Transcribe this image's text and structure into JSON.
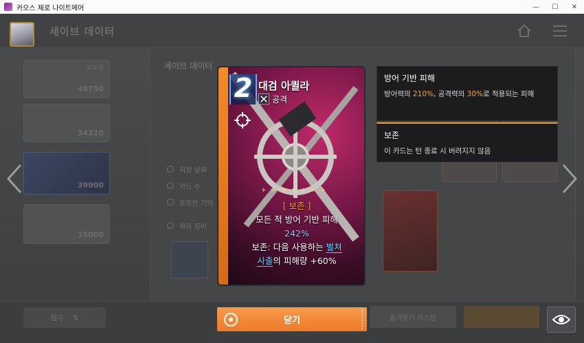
{
  "window": {
    "title": "카오스 제로 나이트메어",
    "minimize": "—",
    "maximize": "☐",
    "close": "✕"
  },
  "background": {
    "page_title": "세이브 데이터",
    "panel_title": "세이브 데이터",
    "slots": [
      {
        "status": "",
        "score": "49750"
      },
      {
        "status": "",
        "score": "34320"
      },
      {
        "status": "",
        "score": "39900"
      },
      {
        "status": "",
        "score": "15000"
      }
    ],
    "slot_header": "장착 중",
    "info_rows": [
      "저장 날짜",
      "카드 수",
      "흐릿한 기억"
    ],
    "equip_label": "획득 장비",
    "sort_label": "점수",
    "ghost_button_label": "즐겨찾기 커스텀"
  },
  "card": {
    "cost": "2",
    "name": "대검 아퀼라",
    "type": "공격",
    "sparkles": "+ + + ✦ + + +",
    "keyword": "[ 보존 ]",
    "line1": "모든 적 방어 기반 피해",
    "line2_value": "242%",
    "line3_prefix": "보존: 다음 사용하는 ",
    "line3_link": "벌쳐",
    "line4_link": "사출",
    "line4_suffix": "의 피해량 ",
    "line4_value": "+60%"
  },
  "tooltips": [
    {
      "title": "방어 기반 피해",
      "body_prefix": "방어력의 ",
      "body_val1": "210%",
      "body_mid": ", 공격력의 ",
      "body_val2": "30%",
      "body_suffix": "로 적용되는 피해"
    },
    {
      "title": "보존",
      "body": "이 카드는 턴 종료 시 버려지지 않음"
    }
  ],
  "close_button": {
    "label": "닫기"
  },
  "colors": {
    "accent_orange": "#ed7a2a",
    "keyword_orange": "#f5a03a",
    "value_cyan": "#6fd0ff"
  }
}
